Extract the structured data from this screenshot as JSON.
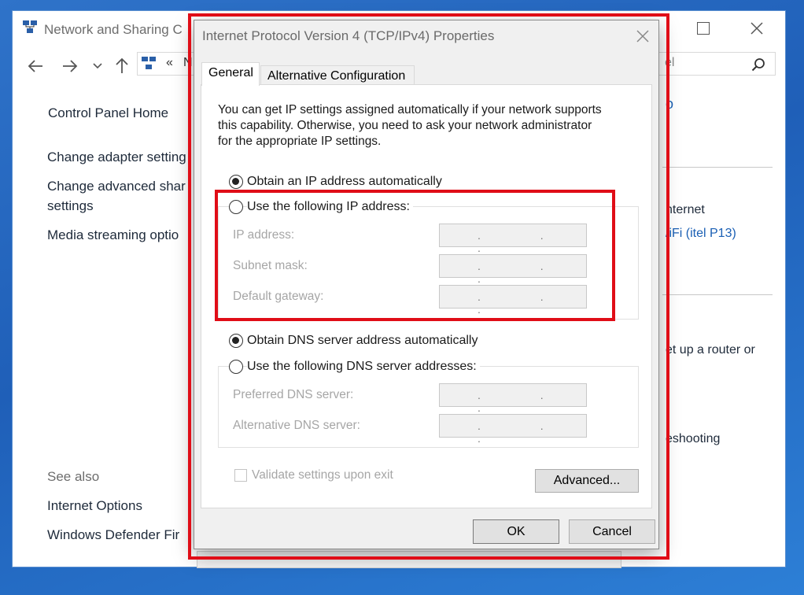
{
  "background_window": {
    "title": "Network and Sharing C",
    "address_prefix": "«",
    "address_fragment": "N",
    "address_tail": "el",
    "sidebar": {
      "home": "Control Panel Home",
      "items": [
        "Change adapter setting",
        "Change advanced shar",
        "settings",
        "Media streaming optio"
      ],
      "see_also_header": "See also",
      "see_also": [
        "Internet Options",
        "Windows Defender Fir"
      ]
    },
    "right_fragments": {
      "link_top": "o",
      "internet": "nternet",
      "wifi": "/iFi (itel P13)",
      "router": "et up a router or",
      "troubleshoot": "eshooting"
    }
  },
  "dialog": {
    "title": "Internet Protocol Version 4 (TCP/IPv4) Properties",
    "tabs": [
      {
        "label": "General",
        "active": true
      },
      {
        "label": "Alternative Configuration",
        "active": false
      }
    ],
    "description_lines": [
      "You can get IP settings assigned automatically if your network supports",
      "this capability. Otherwise, you need to ask your network administrator",
      "for the appropriate IP settings."
    ],
    "ip_mode": {
      "auto_label": "Obtain an IP address automatically",
      "manual_label": "Use the following IP address:",
      "selected": "auto"
    },
    "ip_fields": [
      {
        "label": "IP address:",
        "value": ". . ."
      },
      {
        "label": "Subnet mask:",
        "value": ". . ."
      },
      {
        "label": "Default gateway:",
        "value": ". . ."
      }
    ],
    "dns_mode": {
      "auto_label": "Obtain DNS server address automatically",
      "manual_label": "Use the following DNS server addresses:",
      "selected": "auto"
    },
    "dns_fields": [
      {
        "label": "Preferred DNS server:",
        "value": ". . ."
      },
      {
        "label": "Alternative DNS server:",
        "value": ". . ."
      }
    ],
    "validate_label": "Validate settings upon exit",
    "advanced_label": "Advanced...",
    "ok_label": "OK",
    "cancel_label": "Cancel"
  },
  "colors": {
    "annotation_red": "#e00d17",
    "link_blue": "#1a5fb4",
    "desktop_blue": "#2f73c9"
  }
}
